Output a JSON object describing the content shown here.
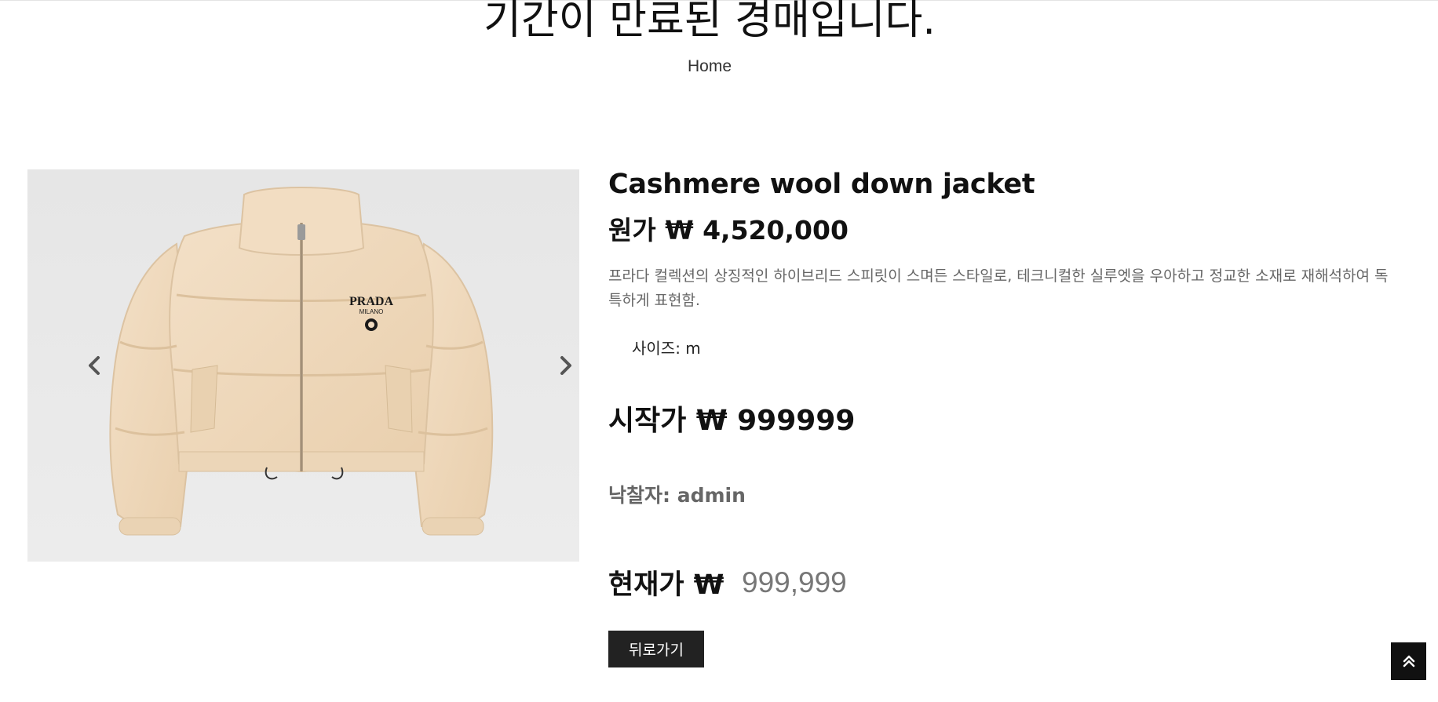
{
  "page": {
    "title": "기간이 만료된 경매입니다.",
    "breadcrumb": "Home"
  },
  "carousel": {
    "prev_icon": "chevron-left-icon",
    "next_icon": "chevron-right-icon",
    "image_subject": "cropped cashmere wool puffer jacket",
    "logo_text": "PRADA",
    "logo_subtext": "MILANO"
  },
  "product": {
    "name": "Cashmere wool down jacket",
    "original_price": "원가 ₩ 4,520,000",
    "description": "프라다 컬렉션의 상징적인 하이브리드 스피릿이 스며든 스타일로, 테크니컬한 실루엣을 우아하고 정교한 소재로 재해석하여 독특하게 표현함.",
    "size": "사이즈: m",
    "start_price": "시작가 ₩ 999999",
    "winner": "낙찰자: admin",
    "current_price_label": "현재가 ₩",
    "current_price_value": "999,999"
  },
  "actions": {
    "back_label": "뒤로가기",
    "scroll_top_icon": "double-chevron-up-icon"
  },
  "colors": {
    "button_bg": "#222222",
    "jacket": "#f1dcc1",
    "image_bg": "#e9e9e9"
  }
}
